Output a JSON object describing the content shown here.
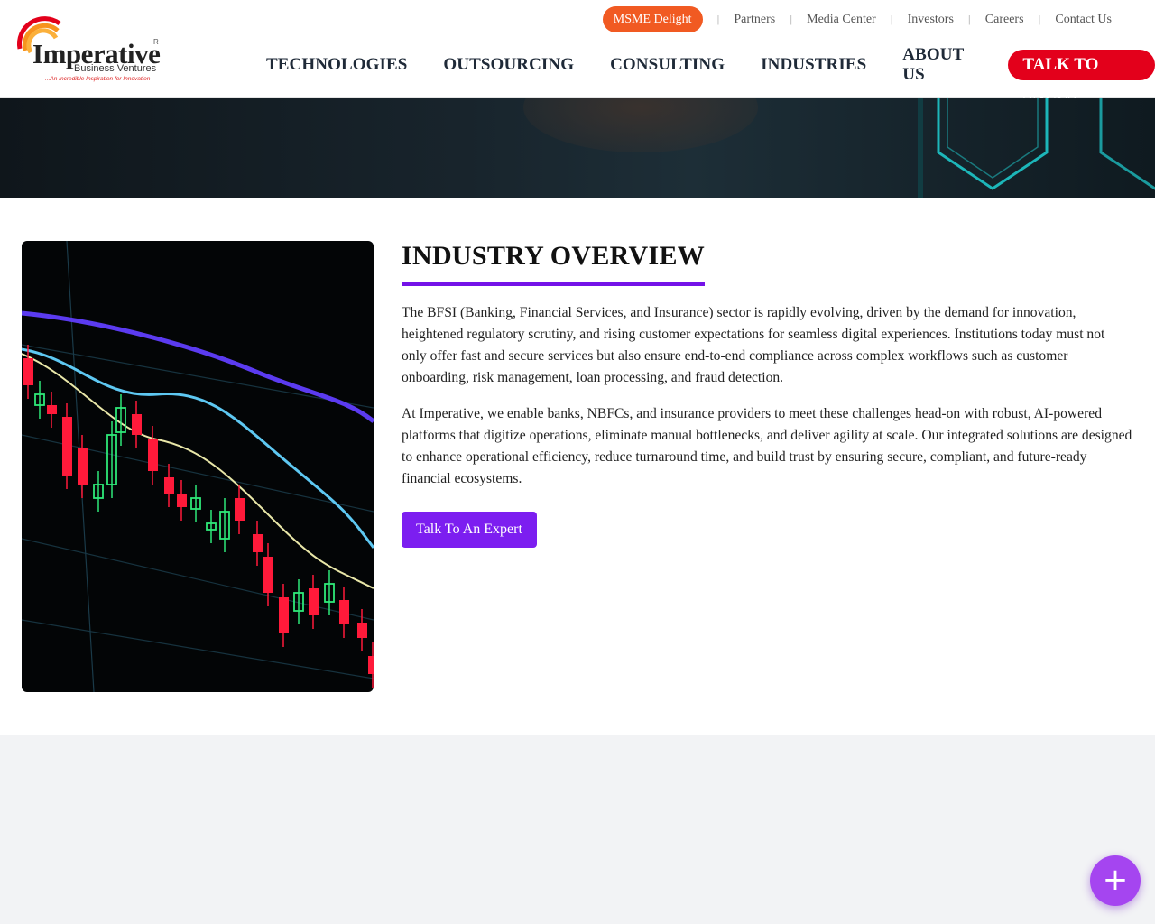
{
  "header": {
    "logo": {
      "wordmark": "Imperative",
      "registered": "R",
      "subtitle": "Business Ventures",
      "tagline": "...An Incredible Inspiration for Innovation"
    },
    "topbar": {
      "msme": "MSME Delight",
      "separator": "|",
      "links": [
        "Partners",
        "Media Center",
        "Investors",
        "Careers",
        "Contact Us"
      ]
    },
    "nav": {
      "items": [
        "TECHNOLOGIES",
        "OUTSOURCING",
        "CONSULTING",
        "INDUSTRIES",
        "ABOUT US"
      ],
      "cta": "TALK TO SALES"
    }
  },
  "overview": {
    "title": "INDUSTRY OVERVIEW",
    "paragraphs": [
      "The BFSI (Banking, Financial Services, and Insurance) sector is rapidly evolving, driven by the demand for innovation, heightened regulatory scrutiny, and rising customer expectations for seamless digital experiences. Institutions today must not only offer fast and secure services but also ensure end-to-end compliance across complex workflows such as customer onboarding, risk management, loan processing, and fraud detection.",
      "At Imperative, we enable banks, NBFCs, and insurance providers to meet these challenges head-on with robust, AI-powered platforms that digitize operations, eliminate manual bottlenecks, and deliver agility at scale. Our integrated solutions are designed to enhance operational efficiency, reduce turnaround time, and build trust by ensuring secure, compliant, and future-ready financial ecosystems."
    ],
    "button": "Talk To An Expert"
  },
  "fab": {
    "icon": "plus-icon",
    "glyph": "+"
  },
  "colors": {
    "msme": "#f15a22",
    "cta_red": "#e3001b",
    "accent_purple": "#7412e8",
    "button_purple": "#7c1ef0",
    "fab_purple": "#a545f0",
    "nav_text": "#1f2a38"
  }
}
